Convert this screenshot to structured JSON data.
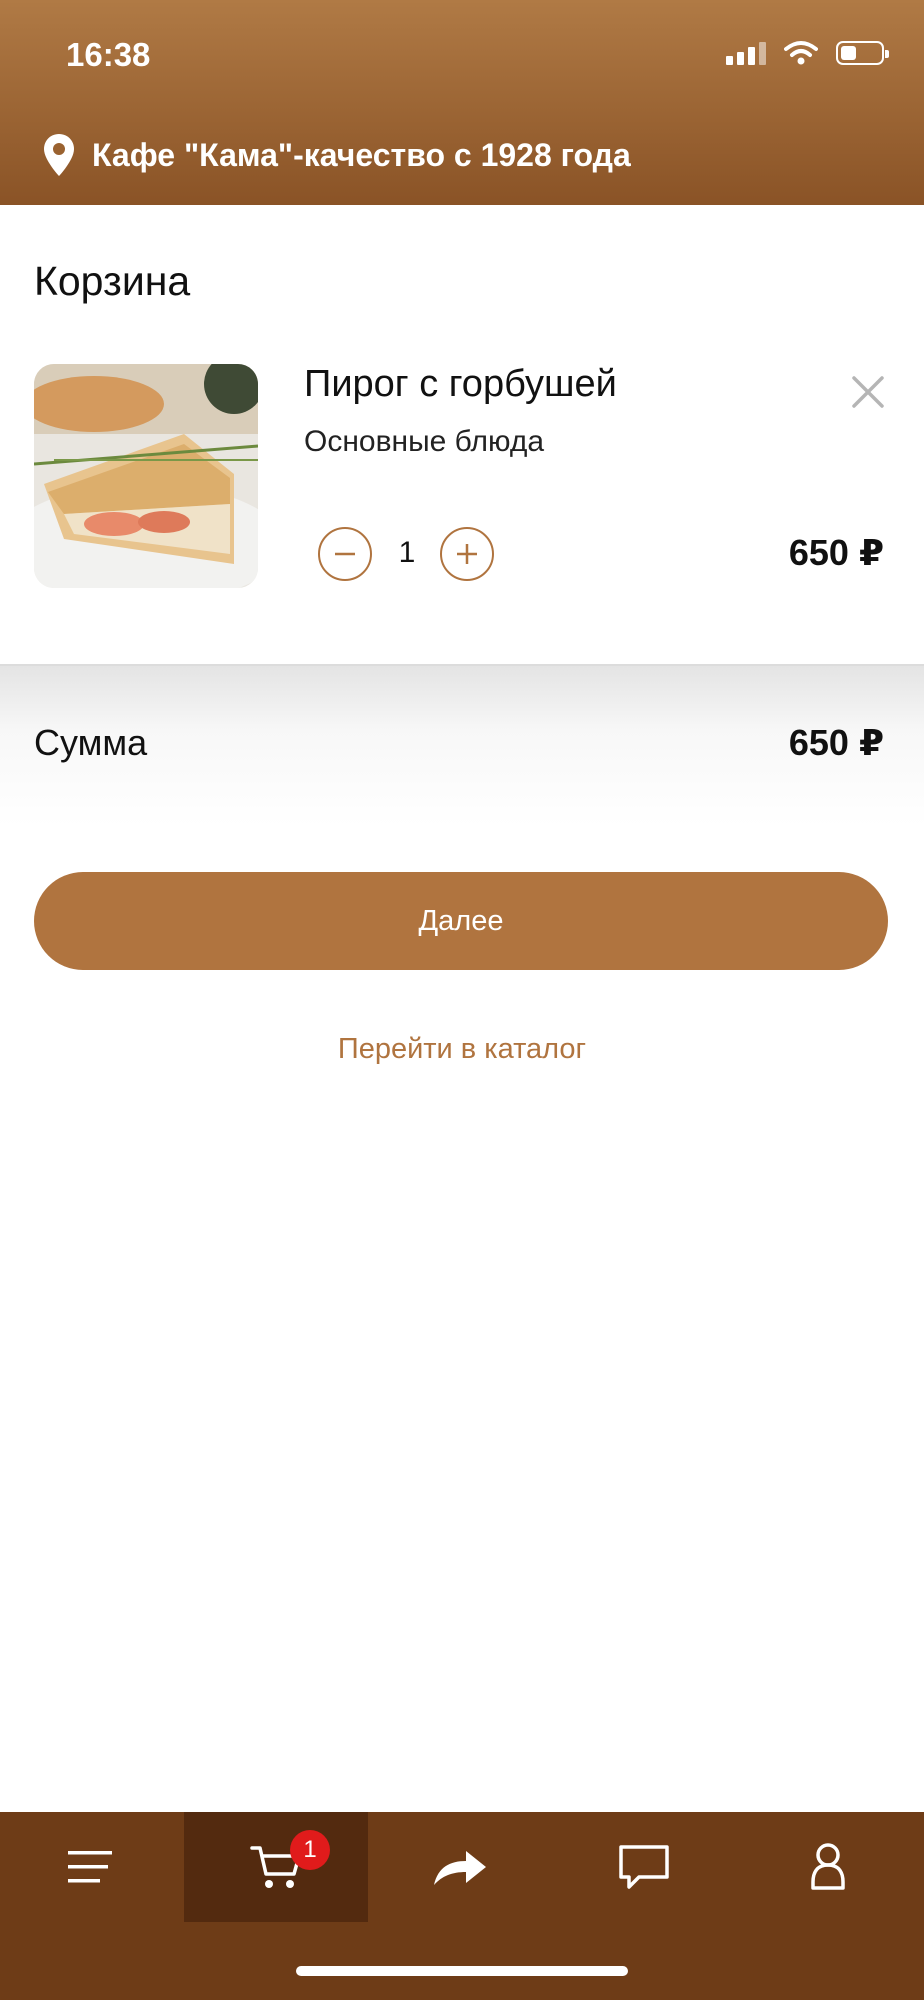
{
  "status": {
    "time": "16:38"
  },
  "header": {
    "location_text": "Кафе \"Кама\"-качество с 1928 года"
  },
  "page": {
    "title": "Корзина"
  },
  "cart": {
    "items": [
      {
        "name": "Пирог с горбушей",
        "category": "Основные блюда",
        "quantity": "1",
        "price": "650 ₽"
      }
    ]
  },
  "summary": {
    "label": "Сумма",
    "value": "650 ₽"
  },
  "actions": {
    "next_label": "Далее",
    "catalog_label": "Перейти в каталог"
  },
  "tabbar": {
    "cart_badge": "1",
    "tabs": [
      "menu-icon",
      "cart-icon",
      "share-icon",
      "chat-icon",
      "profile-icon"
    ]
  },
  "colors": {
    "accent": "#b0743f",
    "header": "#8a5326",
    "tabbar": "#6e3c17",
    "badge": "#e01b1b"
  }
}
